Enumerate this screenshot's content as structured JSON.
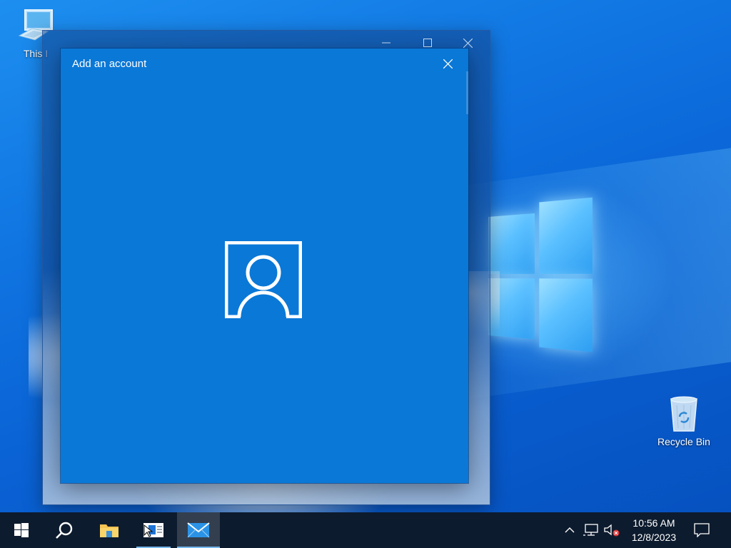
{
  "desktop": {
    "icons": [
      {
        "label": "This PC",
        "visible_label": "This I"
      },
      {
        "label": "Recycle Bin"
      }
    ]
  },
  "dialog": {
    "title": "Add an account"
  },
  "taskbar": {
    "clock": {
      "time": "10:56 AM",
      "date": "12/8/2023"
    }
  },
  "colors": {
    "dialog_bg": "#0a78d7",
    "taskbar_bg": "#0d1b2e",
    "accent": "#76b9ed"
  }
}
